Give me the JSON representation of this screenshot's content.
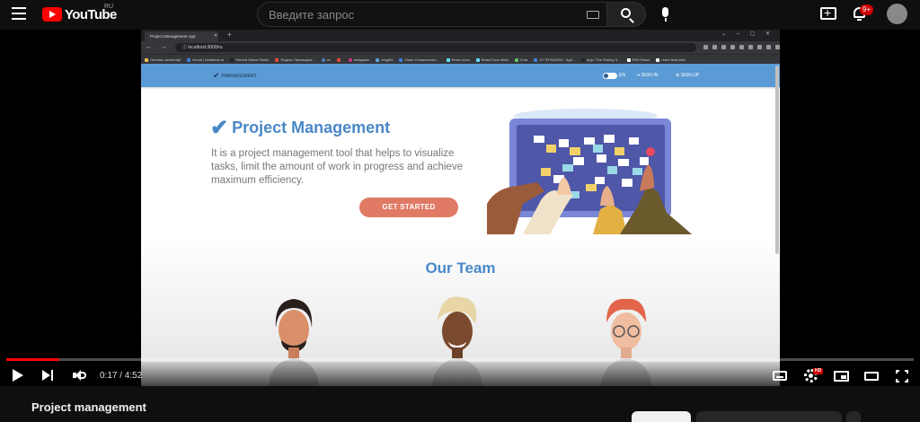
{
  "youtube": {
    "logo_text": "YouTube",
    "region": "RU",
    "search_placeholder": "Введите запрос",
    "notifications_badge": "9+"
  },
  "inner_browser": {
    "tab_title": "Project Management App",
    "url": "localhost:3000/ru",
    "bookmarks": [
      {
        "label": "Основы JavaScript",
        "color": "#f2c14e"
      },
      {
        "label": "Home | htmlbook.ru",
        "color": "#3d7fd6"
      },
      {
        "label": "Record Dance Radio",
        "color": "#222222"
      },
      {
        "label": "Яндекс Переводчи...",
        "color": "#e04b3a"
      },
      {
        "label": "vk",
        "color": "#4a76a8"
      },
      {
        "label": "",
        "color": "#e04b3a"
      },
      {
        "label": "Instagram",
        "color": "#c13584"
      },
      {
        "label": "emgfild",
        "color": "#5aa0e0"
      },
      {
        "label": "Class Components |...",
        "color": "#3d7fd6"
      },
      {
        "label": "React docs",
        "color": "#61dafb"
      },
      {
        "label": "React Docs Beta",
        "color": "#61dafb"
      },
      {
        "label": "Chat",
        "color": "#5fbf6a"
      },
      {
        "label": "JS TR BOARD - Agil...",
        "color": "#3d7fd6"
      },
      {
        "label": "App / The Rolling S...",
        "color": "#222222"
      },
      {
        "label": "RSS React",
        "color": "#ffffff"
      },
      {
        "label": "react-final-task",
        "color": "#ffffff"
      }
    ]
  },
  "app": {
    "logo_text": "PMANAGEMENT",
    "lang": "EN",
    "sign_in": "SIGN IN",
    "sign_up": "SIGN UP",
    "hero_title": "Project Management",
    "hero_desc": "It is a project management tool that helps to visualize tasks, limit the amount of work in progress and achieve maximum efficiency.",
    "cta": "GET STARTED",
    "team_title": "Our Team"
  },
  "player": {
    "time": "0:17 / 4:52",
    "progress_fraction": 0.058,
    "quality_badge": "HD"
  },
  "video_info": {
    "title": "Project management"
  },
  "colors": {
    "yt_red": "#ff0000",
    "app_blue": "#5b9bd5",
    "title_blue": "#4a88c7",
    "cta_coral": "#e07a65"
  }
}
